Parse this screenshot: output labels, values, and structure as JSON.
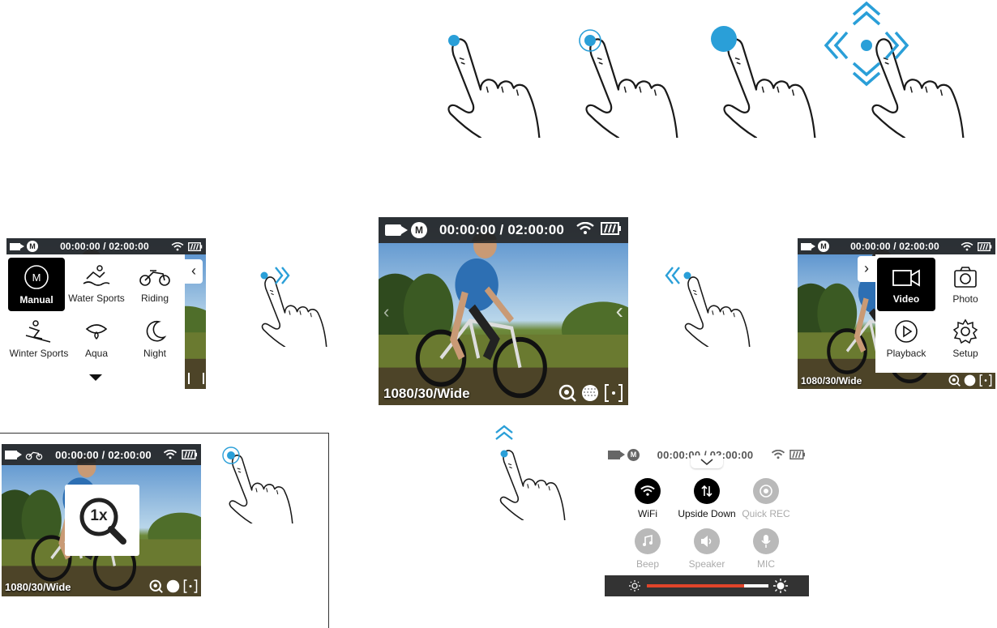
{
  "colors": {
    "accent": "#2a9fd8",
    "statusbar": "#2b2b2b",
    "brightness": "#e0442a"
  },
  "gestures": [
    {
      "name": "tap",
      "icon": "tap-icon"
    },
    {
      "name": "press",
      "icon": "press-icon"
    },
    {
      "name": "hold",
      "icon": "hold-icon"
    },
    {
      "name": "swipe",
      "icon": "swipe-icon"
    }
  ],
  "screens": {
    "main": {
      "timecode": "00:00:00 / 02:00:00",
      "mode": "M",
      "resolution": "1080/30/Wide"
    },
    "scene_menu": {
      "timecode": "00:00:00 / 02:00:00",
      "mode": "M",
      "items": [
        {
          "label": "Manual",
          "icon": "manual-icon",
          "selected": true
        },
        {
          "label": "Water Sports",
          "icon": "water-sports-icon"
        },
        {
          "label": "Riding",
          "icon": "riding-icon"
        },
        {
          "label": "Winter Sports",
          "icon": "winter-sports-icon"
        },
        {
          "label": "Aqua",
          "icon": "aqua-icon"
        },
        {
          "label": "Night",
          "icon": "night-icon"
        }
      ]
    },
    "mode_menu": {
      "timecode": "00:00:00 / 02:00:00",
      "mode": "M",
      "resolution": "1080/30/Wide",
      "items": [
        {
          "label": "Video",
          "icon": "video-icon",
          "selected": true
        },
        {
          "label": "Photo",
          "icon": "photo-icon"
        },
        {
          "label": "Playback",
          "icon": "playback-icon"
        },
        {
          "label": "Setup",
          "icon": "setup-icon"
        }
      ]
    },
    "zoom": {
      "timecode": "00:00:00 / 02:00:00",
      "zoom_label": "1x",
      "resolution": "1080/30/Wide"
    },
    "quick_settings": {
      "timecode": "00:00:00 / 02:00:00",
      "mode": "M",
      "items": [
        {
          "label": "WiFi",
          "icon": "wifi-icon",
          "active": true
        },
        {
          "label": "Upside Down",
          "icon": "upside-down-icon",
          "active": true
        },
        {
          "label": "Quick REC",
          "icon": "quick-rec-icon",
          "active": false
        },
        {
          "label": "Beep",
          "icon": "beep-icon",
          "active": false
        },
        {
          "label": "Speaker",
          "icon": "speaker-icon",
          "active": false
        },
        {
          "label": "MIC",
          "icon": "mic-icon",
          "active": false
        }
      ],
      "brightness": 0.8
    }
  }
}
